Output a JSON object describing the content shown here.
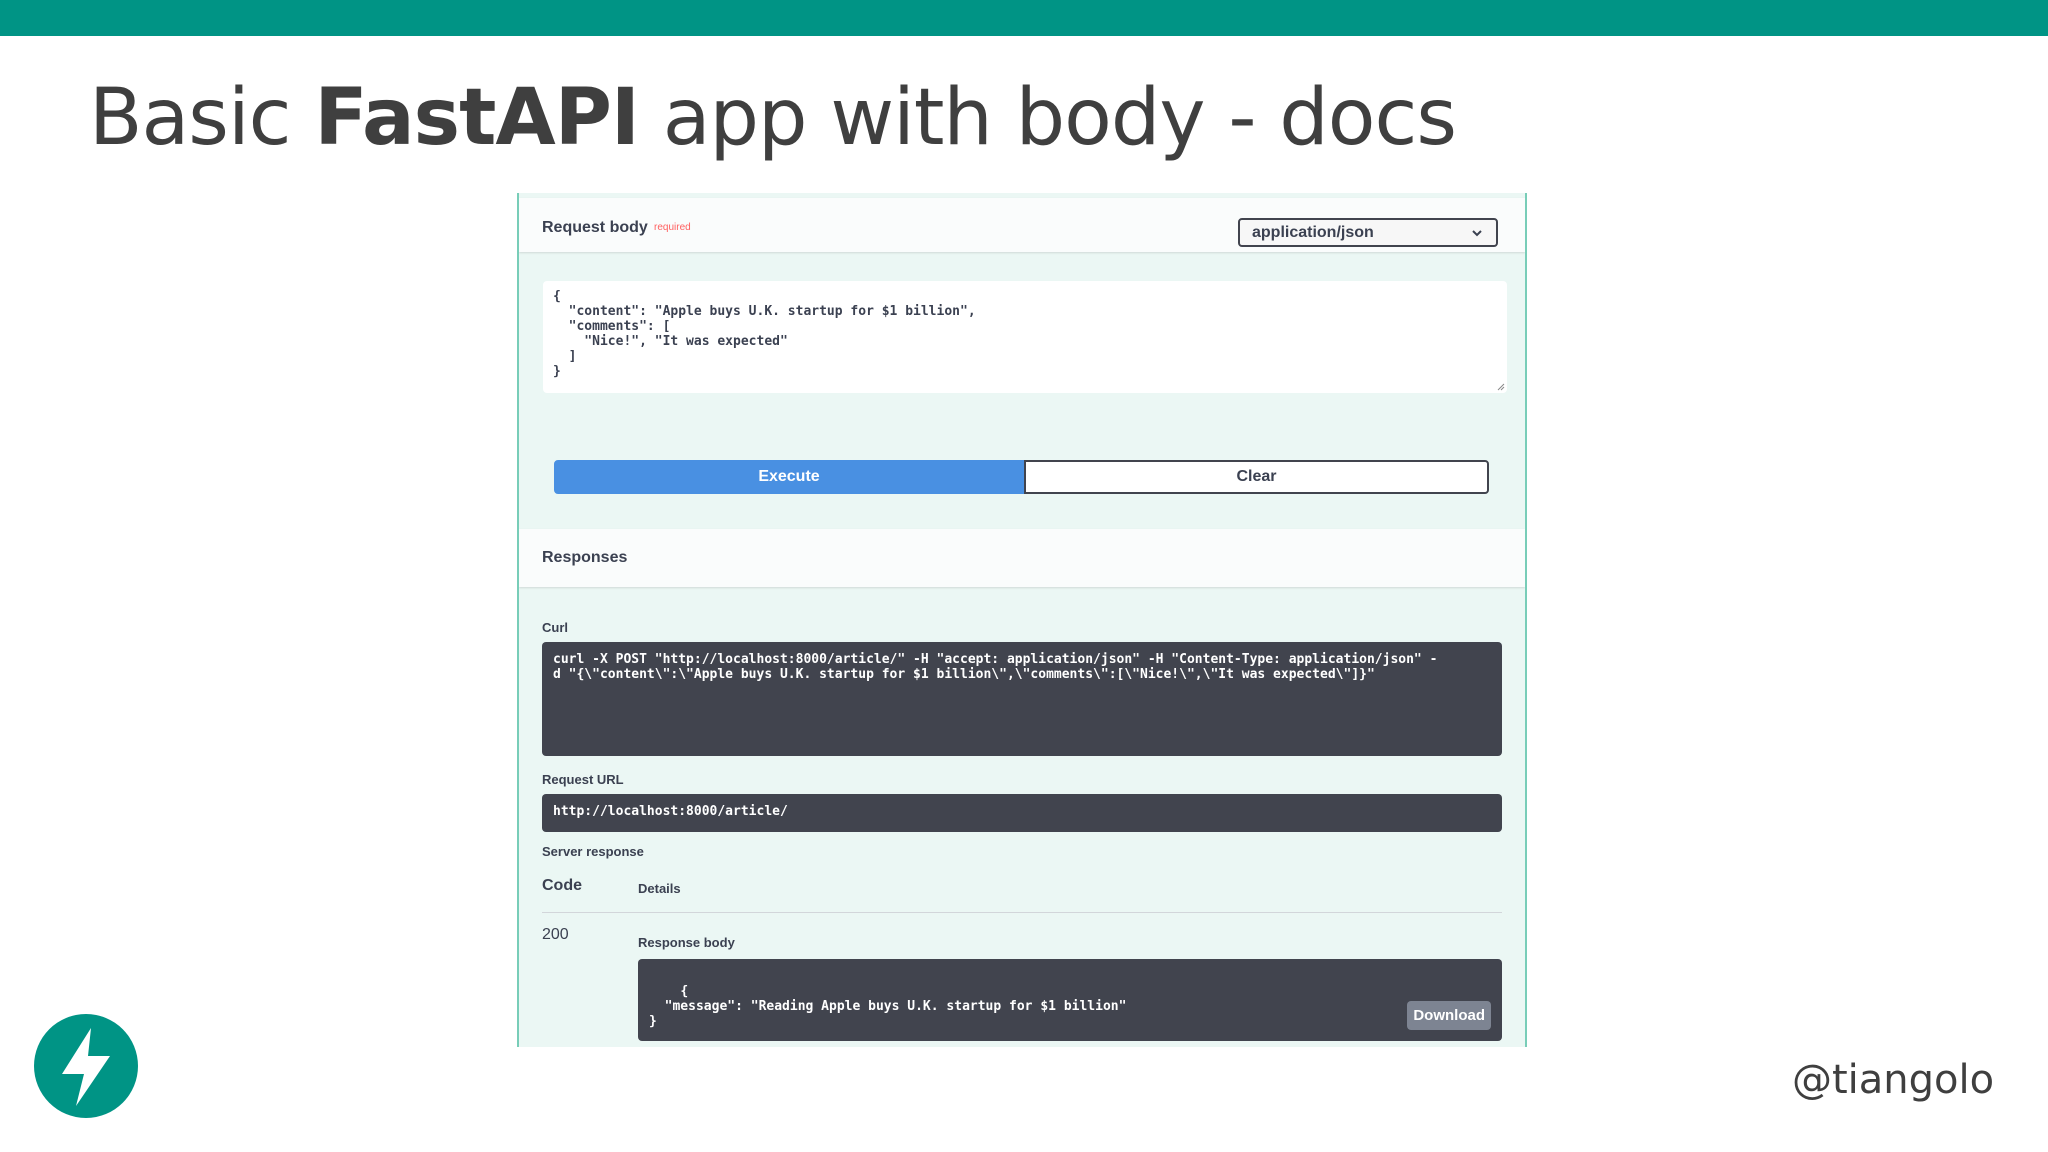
{
  "slide": {
    "title_prefix": "Basic",
    "title_bold": "FastAPI",
    "title_suffix": "app with body - docs",
    "author_handle": "@tiangolo",
    "accent_color": "#009485"
  },
  "request_body": {
    "label": "Request body",
    "required_label": "required",
    "content_type": "application/json",
    "value": "{\n  \"content\": \"Apple buys U.K. startup for $1 billion\",\n  \"comments\": [\n    \"Nice!\", \"It was expected\"\n  ]\n}"
  },
  "actions": {
    "execute_label": "Execute",
    "clear_label": "Clear"
  },
  "responses": {
    "title": "Responses",
    "curl_label": "Curl",
    "curl_command": "curl -X POST \"http://localhost:8000/article/\" -H \"accept: application/json\" -H \"Content-Type: application/json\" -\nd \"{\\\"content\\\":\\\"Apple buys U.K. startup for $1 billion\\\",\\\"comments\\\":[\\\"Nice!\\\",\\\"It was expected\\\"]}\"",
    "request_url_label": "Request URL",
    "request_url": "http://localhost:8000/article/",
    "server_response_label": "Server response",
    "code_header": "Code",
    "details_header": "Details",
    "status_code": "200",
    "response_body_label": "Response body",
    "response_body": "{\n  \"message\": \"Reading Apple buys U.K. startup for $1 billion\"\n}",
    "download_label": "Download"
  },
  "colors": {
    "execute_button": "#4990e2",
    "code_block_bg": "#41444e",
    "panel_bg": "#ebf7f4",
    "required": "#ff6060"
  },
  "icons": {
    "select_caret": "chevron-down-icon",
    "logo": "fastapi-lightning-logo-icon"
  }
}
